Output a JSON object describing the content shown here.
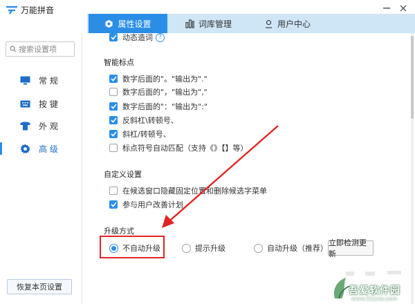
{
  "window": {
    "title": "万能拼音"
  },
  "tabs": [
    {
      "label": "属性设置",
      "active": true,
      "icon": "hexagon-icon"
    },
    {
      "label": "词库管理",
      "active": false,
      "icon": "bars-icon"
    },
    {
      "label": "用户中心",
      "active": false,
      "icon": "user-icon"
    }
  ],
  "sidebar": {
    "search_placeholder": "搜索设置项",
    "items": [
      {
        "label": "常 规",
        "icon": "monitor-icon",
        "active": false
      },
      {
        "label": "按 键",
        "icon": "keyboard-icon",
        "active": false
      },
      {
        "label": "外 观",
        "icon": "shirt-icon",
        "active": false
      },
      {
        "label": "高 级",
        "icon": "gear-icon",
        "active": true
      }
    ],
    "restore_label": "恢复本页设置"
  },
  "main": {
    "partial_option": {
      "label": "动态造词",
      "checked": true
    },
    "smart_punct": {
      "title": "智能标点",
      "options": [
        {
          "label": "数字后面的\"。\"输出为\".\"",
          "checked": true
        },
        {
          "label": "数字后面的\"，\"输出为\",\"",
          "checked": false
        },
        {
          "label": "数字后面的\"：\"输出为\":\"",
          "checked": true
        },
        {
          "label": "反斜杠\\转顿号、",
          "checked": true
        },
        {
          "label": "斜杠/转顿号、",
          "checked": true
        },
        {
          "label": "标点符号自动匹配（支持《》【】等）",
          "checked": false
        }
      ]
    },
    "custom": {
      "title": "自定义设置",
      "options": [
        {
          "label": "在候选窗口隐藏固定位置和删除候选字菜单",
          "checked": false
        },
        {
          "label": "参与用户改善计划",
          "checked": true
        }
      ]
    },
    "upgrade": {
      "title": "升级方式",
      "options": [
        {
          "label": "不自动升级",
          "checked": true
        },
        {
          "label": "提示升级",
          "checked": false
        },
        {
          "label": "自动升级（推荐）",
          "checked": false
        }
      ],
      "check_now_label": "立即检测更新"
    }
  },
  "watermark": {
    "brand": "吾爱软件园",
    "url": "www.52zxw.com"
  },
  "colors": {
    "accent": "#2b8ee6",
    "tab_bar": "#cfe6f7",
    "annotation": "#e02424"
  }
}
